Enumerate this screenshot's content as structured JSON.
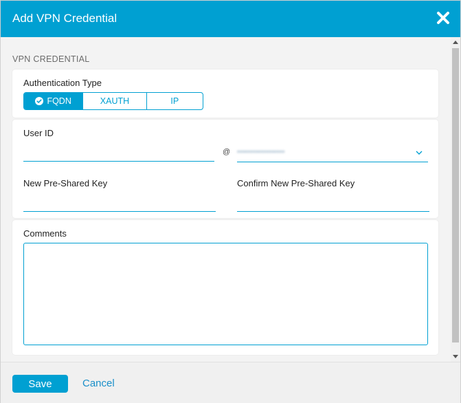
{
  "header": {
    "title": "Add VPN Credential"
  },
  "section": {
    "title": "VPN CREDENTIAL"
  },
  "auth": {
    "label": "Authentication Type",
    "options": [
      {
        "label": "FQDN",
        "active": true
      },
      {
        "label": "XAUTH",
        "active": false
      },
      {
        "label": "IP",
        "active": false
      }
    ]
  },
  "user": {
    "user_id_label": "User ID",
    "user_id_value": "",
    "at_symbol": "@",
    "domain_value": "••••••••••••••••••",
    "psk_label": "New Pre-Shared Key",
    "psk_value": "",
    "confirm_psk_label": "Confirm New Pre-Shared Key",
    "confirm_psk_value": ""
  },
  "comments": {
    "label": "Comments",
    "value": ""
  },
  "footer": {
    "save_label": "Save",
    "cancel_label": "Cancel"
  },
  "colors": {
    "accent": "#00a0d2",
    "header_bg": "#00a0d2",
    "body_bg": "#f3f3f3"
  },
  "icons": {
    "close": "close-icon",
    "check": "check-circle-icon",
    "chevron": "chevron-down-icon"
  }
}
